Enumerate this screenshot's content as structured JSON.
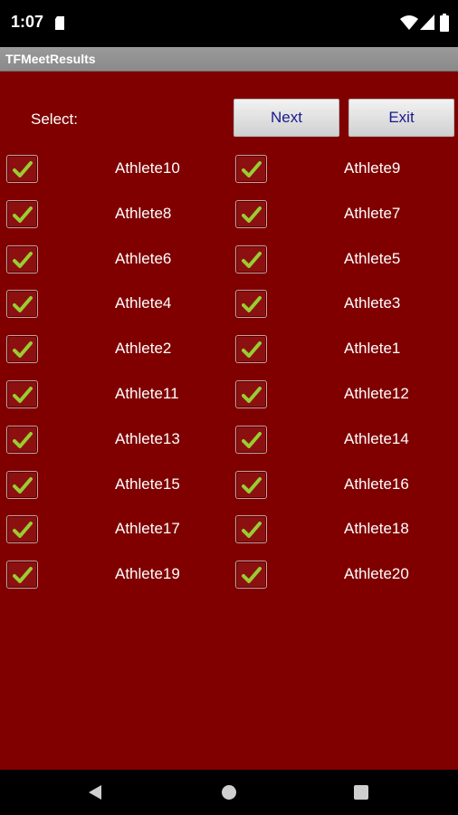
{
  "status_bar": {
    "time": "1:07",
    "icons": [
      "sd-card-icon",
      "wifi-icon",
      "signal-icon",
      "battery-icon"
    ]
  },
  "app": {
    "title": "TFMeetResults"
  },
  "header": {
    "select_label": "Select:",
    "next_label": "Next",
    "exit_label": "Exit"
  },
  "athletes": [
    {
      "left": {
        "name": "Athlete10",
        "checked": true
      },
      "right": {
        "name": "Athlete9",
        "checked": true
      }
    },
    {
      "left": {
        "name": "Athlete8",
        "checked": true
      },
      "right": {
        "name": "Athlete7",
        "checked": true
      }
    },
    {
      "left": {
        "name": "Athlete6",
        "checked": true
      },
      "right": {
        "name": "Athlete5",
        "checked": true
      }
    },
    {
      "left": {
        "name": "Athlete4",
        "checked": true
      },
      "right": {
        "name": "Athlete3",
        "checked": true
      }
    },
    {
      "left": {
        "name": "Athlete2",
        "checked": true
      },
      "right": {
        "name": "Athlete1",
        "checked": true
      }
    },
    {
      "left": {
        "name": "Athlete11",
        "checked": true
      },
      "right": {
        "name": "Athlete12",
        "checked": true
      }
    },
    {
      "left": {
        "name": "Athlete13",
        "checked": true
      },
      "right": {
        "name": "Athlete14",
        "checked": true
      }
    },
    {
      "left": {
        "name": "Athlete15",
        "checked": true
      },
      "right": {
        "name": "Athlete16",
        "checked": true
      }
    },
    {
      "left": {
        "name": "Athlete17",
        "checked": true
      },
      "right": {
        "name": "Athlete18",
        "checked": true
      }
    },
    {
      "left": {
        "name": "Athlete19",
        "checked": true
      },
      "right": {
        "name": "Athlete20",
        "checked": true
      }
    }
  ],
  "colors": {
    "background": "#800000",
    "checkmark": "#9acd32",
    "button_text": "#1a1a8c"
  },
  "nav_bar": {
    "icons": [
      "back-icon",
      "home-icon",
      "recents-icon"
    ]
  }
}
